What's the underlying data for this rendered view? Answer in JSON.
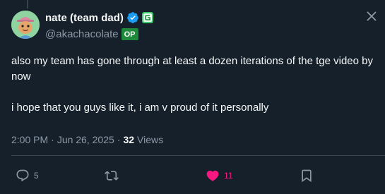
{
  "tweet": {
    "author": {
      "display_name": "nate (team dad)",
      "handle": "@akachacolate",
      "op_badge": "OP",
      "avatar_icon": "frog-avatar-icon",
      "verified": true
    },
    "paragraphs": [
      "also my team has gone through at least a dozen iterations of the tge video by now",
      "i hope that you guys like it, i am v proud of it personally"
    ],
    "meta": {
      "time": "2:00 PM",
      "date": "Jun 26, 2025",
      "separator": "·",
      "views_count": "32",
      "views_label": "Views"
    },
    "actions": {
      "replies": "5",
      "reposts": "",
      "likes": "11",
      "liked": true
    }
  },
  "colors": {
    "background": "#15202b",
    "text": "#f7f9f9",
    "muted": "#8b98a5",
    "verified": "#1d9bf0",
    "like": "#f91880",
    "op_badge": "#1f8a3b"
  }
}
